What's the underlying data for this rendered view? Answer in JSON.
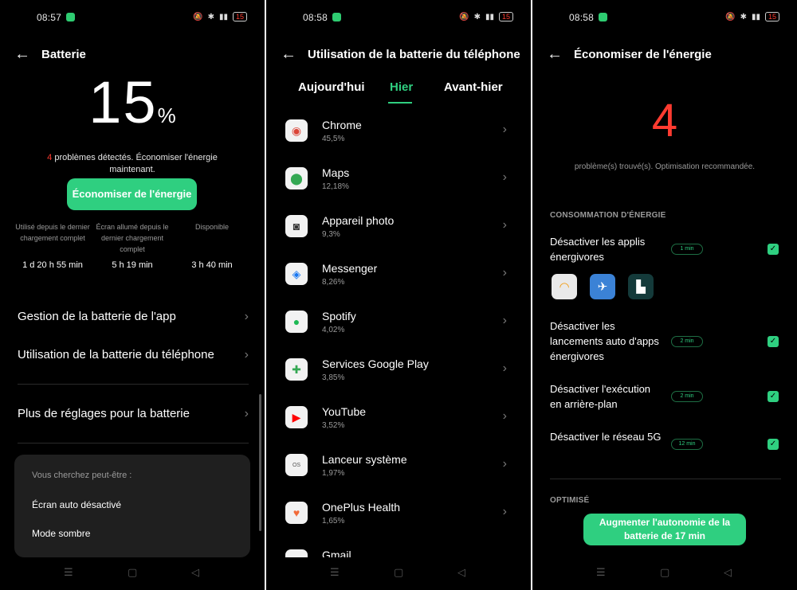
{
  "panel1": {
    "status": {
      "time": "08:57",
      "battery": "15"
    },
    "title": "Batterie",
    "percent": "15",
    "percent_sign": "%",
    "problems_count": "4",
    "problems_text": " problèmes détectés. Économiser l'énergie maintenant.",
    "save_button": "Économiser de l'énergie",
    "stats": [
      {
        "label": "Utilisé depuis le dernier chargement complet",
        "value": "1 d 20 h 55 min"
      },
      {
        "label": "Écran allumé depuis le dernier chargement complet",
        "value": "5 h 19 min"
      },
      {
        "label": "Disponible",
        "value": "3 h 40 min"
      }
    ],
    "menu": [
      "Gestion de la batterie de l'app",
      "Utilisation de la batterie du téléphone",
      "Plus de réglages pour la batterie"
    ],
    "suggest": {
      "head": "Vous cherchez peut-être :",
      "items": [
        "Écran auto désactivé",
        "Mode sombre"
      ]
    }
  },
  "panel2": {
    "status": {
      "time": "08:58",
      "battery": "15"
    },
    "title": "Utilisation de la batterie du téléphone",
    "tabs": [
      "Aujourd'hui",
      "Hier",
      "Avant-hier"
    ],
    "active_tab": "Hier",
    "apps": [
      {
        "name": "Chrome",
        "pct": "45,5%",
        "icon": "chrome-icon"
      },
      {
        "name": "Maps",
        "pct": "12,18%",
        "icon": "maps-icon"
      },
      {
        "name": "Appareil photo",
        "pct": "9,3%",
        "icon": "camera-icon"
      },
      {
        "name": "Messenger",
        "pct": "8,26%",
        "icon": "messenger-icon"
      },
      {
        "name": "Spotify",
        "pct": "4,02%",
        "icon": "spotify-icon"
      },
      {
        "name": "Services Google Play",
        "pct": "3,85%",
        "icon": "play-services-icon"
      },
      {
        "name": "YouTube",
        "pct": "3,52%",
        "icon": "youtube-icon"
      },
      {
        "name": "Lanceur système",
        "pct": "1,97%",
        "icon": "launcher-icon"
      },
      {
        "name": "OnePlus Health",
        "pct": "1,65%",
        "icon": "health-icon"
      },
      {
        "name": "Gmail",
        "pct": "",
        "icon": "gmail-icon"
      }
    ]
  },
  "panel3": {
    "status": {
      "time": "08:58",
      "battery": "15"
    },
    "title": "Économiser de l'énergie",
    "count": "4",
    "subtitle": "problème(s) trouvé(s). Optimisation recommandée.",
    "section1": "CONSOMMATION D'ÉNERGIE",
    "options": [
      {
        "text": "Désactiver les applis énergivores",
        "pill": "1 min"
      },
      {
        "text": "Désactiver les lancements auto d'apps énergivores",
        "pill": "2 min"
      },
      {
        "text": "Désactiver l'exécution en arrière-plan",
        "pill": "2 min"
      },
      {
        "text": "Désactiver le réseau 5G",
        "pill": "12 min"
      }
    ],
    "section2": "OPTIMISÉ",
    "button": "Augmenter l'autonomie de la batterie de 17 min",
    "colors": {
      "accent": "#2fcf80",
      "alert": "#ff3b30"
    }
  }
}
